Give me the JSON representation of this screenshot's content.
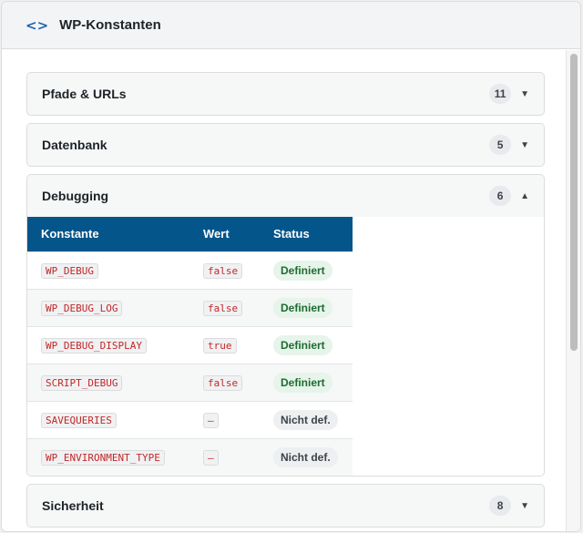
{
  "header": {
    "icon": "code-icon",
    "title": "WP-Konstanten"
  },
  "sections": [
    {
      "label": "Pfade & URLs",
      "count": "11"
    },
    {
      "label": "Datenbank",
      "count": "5"
    },
    {
      "label": "Debugging",
      "count": "6"
    },
    {
      "label": "Sicherheit",
      "count": "8"
    }
  ],
  "table": {
    "headers": [
      "Konstante",
      "Wert",
      "Status"
    ],
    "rows": [
      [
        "WP_DEBUG",
        "false",
        "Definiert"
      ],
      [
        "WP_DEBUG_LOG",
        "false",
        "Definiert"
      ],
      [
        "WP_DEBUG_DISPLAY",
        "true",
        "Definiert"
      ],
      [
        "SCRIPT_DEBUG",
        "false",
        "Definiert"
      ],
      [
        "SAVEQUERIES",
        "—",
        "Nicht def."
      ],
      [
        "WP_ENVIRONMENT_TYPE",
        "—",
        "Nicht def."
      ]
    ]
  },
  "colors": {
    "accent": "#04558a",
    "defined": "#1e6b32",
    "code": "#c2282a"
  }
}
